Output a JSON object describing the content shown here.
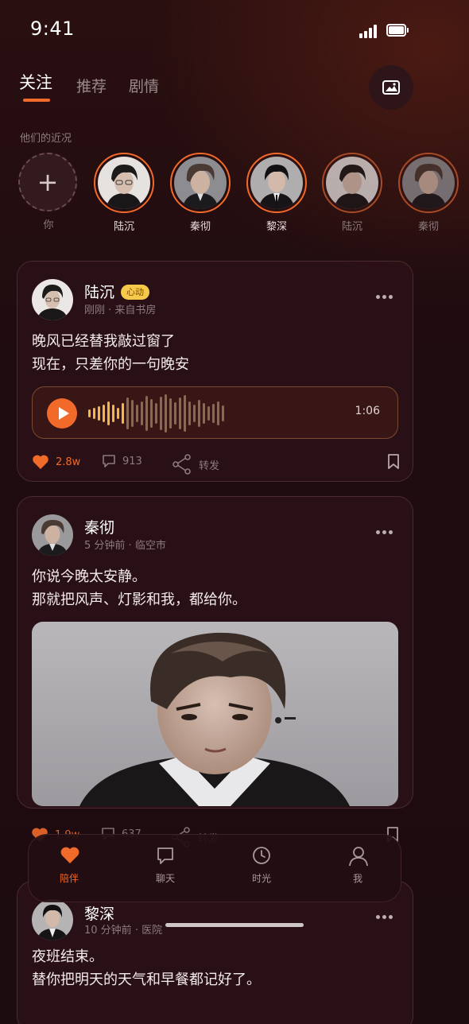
{
  "status_bar": {
    "time": "9:41"
  },
  "tabs": [
    {
      "label": "关注",
      "active": true
    },
    {
      "label": "推荐",
      "active": false
    },
    {
      "label": "剧情",
      "active": false
    }
  ],
  "section_label": "他们的近况",
  "stories": [
    {
      "name": "你",
      "type": "add"
    },
    {
      "name": "陆沉"
    },
    {
      "name": "秦彻"
    },
    {
      "name": "黎深"
    },
    {
      "name": "陆沉",
      "dim": true
    },
    {
      "name": "秦彻",
      "dim": true
    }
  ],
  "posts": [
    {
      "author": "陆沉",
      "badge": "心动",
      "time": "刚刚",
      "location": "来自书房",
      "lines": [
        "晚风已经替我敲过窗了",
        "现在，只差你的一句晚安"
      ],
      "voice": {
        "duration": "1:06"
      },
      "likes": "2.8w",
      "comments": "913",
      "share_label": "转发"
    },
    {
      "author": "秦彻",
      "time": "5 分钟前",
      "location": "临空市",
      "lines": [
        "你说今晚太安静。",
        "那就把风声、灯影和我，都给你。"
      ],
      "likes": "1.9w",
      "comments": "637",
      "share_label": "转发"
    },
    {
      "author": "黎深",
      "time": "10 分钟前",
      "location": "医院",
      "lines": [
        "夜班结束。",
        "替你把明天的天气和早餐都记好了。"
      ]
    }
  ],
  "bottom_nav": [
    {
      "label": "陪伴",
      "icon": "heart-icon",
      "active": true
    },
    {
      "label": "聊天",
      "icon": "chat-icon"
    },
    {
      "label": "时光",
      "icon": "clock-icon"
    },
    {
      "label": "我",
      "icon": "person-icon"
    }
  ],
  "colors": {
    "accent": "#f06a2a",
    "badge": "#f6c94a"
  }
}
